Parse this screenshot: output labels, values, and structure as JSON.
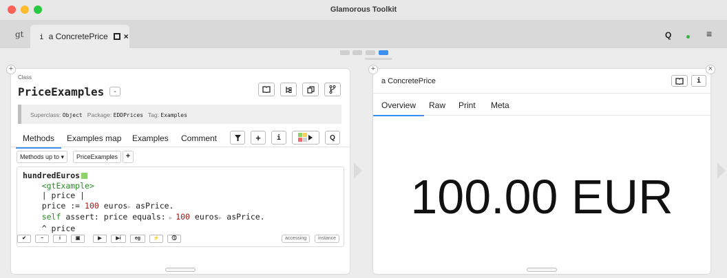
{
  "window": {
    "title": "Glamorous Toolkit"
  },
  "tabbar": {
    "logo": "gt",
    "tab_icon": "i",
    "tab_label": "a ConcretePrice",
    "close_glyph": "×",
    "search_glyph": "Q",
    "menu_glyph": "≡"
  },
  "left": {
    "kind_label": "Class",
    "class_name": "PriceExamples",
    "collapse_glyph": "-",
    "superclass_label": "Superclass:",
    "superclass_value": "Object",
    "package_label": "Package:",
    "package_value": "EDDPrices",
    "tag_label": "Tag:",
    "tag_value": "Examples",
    "tabs": [
      "Methods",
      "Examples map",
      "Examples",
      "Comment"
    ],
    "filter_label": "Methods up to",
    "filter_value": "PriceExamples",
    "add_glyph": "+",
    "info_glyph": "i",
    "code": {
      "method_name": "hundredEuros",
      "pragma": "<gtExample>",
      "temps": "| price |",
      "line1_a": "price := ",
      "line1_num": "100",
      "line1_b": " euros",
      "line1_c": " asPrice.",
      "line2_self": "self",
      "line2_a": " assert: price equals:",
      "line2_num": "100",
      "line2_b": " euros",
      "line2_c": " asPrice.",
      "ret": "^ price"
    },
    "code_buttons": [
      "✔",
      "−",
      "i",
      "▣",
      "▶",
      "▶i",
      "eg",
      "⚡",
      "⓵"
    ],
    "protocol": "accessing",
    "side": "instance"
  },
  "right": {
    "title": "a ConcretePrice",
    "info_glyph": "i",
    "tabs": [
      "Overview",
      "Raw",
      "Print",
      "Meta"
    ],
    "value": "100.00 EUR"
  },
  "colors": {
    "accent": "#3d8ff0",
    "pragma": "#2a8a2a",
    "number": "#a31515"
  }
}
